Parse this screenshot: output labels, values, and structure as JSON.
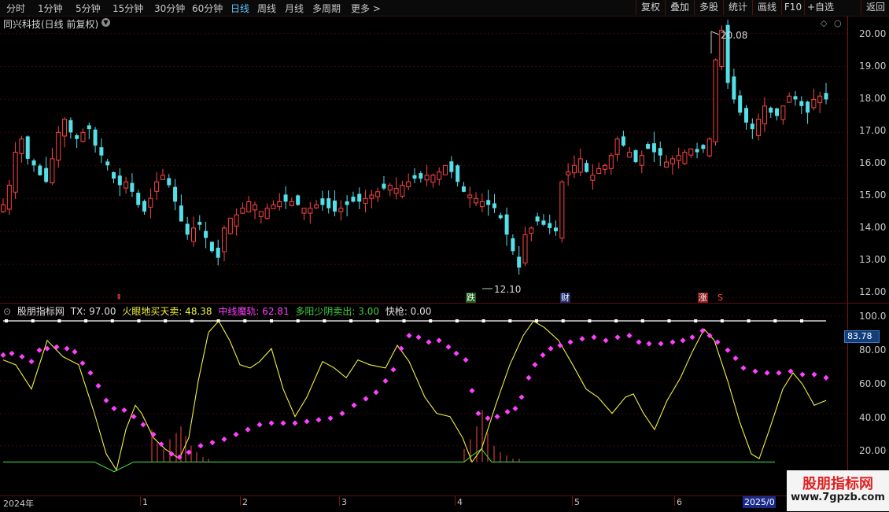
{
  "toolbar": {
    "periods": [
      "分时",
      "1分钟",
      "5分钟",
      "15分钟",
      "30分钟",
      "60分钟",
      "日线",
      "周线",
      "月线",
      "多周期",
      "更多 >"
    ],
    "active_period": "日线",
    "buttons": [
      "复权",
      "叠加",
      "多股",
      "统计",
      "画线",
      "F10",
      "+自选",
      "返回"
    ]
  },
  "stock": {
    "title": "同兴科技(日线 前复权)",
    "high_label": "20.08",
    "low_label": "12.10",
    "y_axis_ticks": [
      "20.00",
      "19.00",
      "18.00",
      "17.00",
      "16.00",
      "15.00",
      "14.00",
      "13.00",
      "12.00"
    ],
    "events": {
      "fall": "跌",
      "finance": "财",
      "rise": "涨",
      "mark_s": "S"
    }
  },
  "indicator": {
    "name": "股朋指标网",
    "items": [
      {
        "text": "TX: 97.00",
        "color": "#e0e0e0"
      },
      {
        "text": "火眼地买天卖: 48.38",
        "color": "#f0f040"
      },
      {
        "text": "中线魔轨: 62.81",
        "color": "#ff40ff"
      },
      {
        "text": "多阳少阴卖出: 3.00",
        "color": "#40d040"
      },
      {
        "text": "快枪: 0.00",
        "color": "#e0e0e0"
      }
    ],
    "y_axis_ticks": [
      "100.0",
      "80.00",
      "60.00",
      "40.00",
      "20.00"
    ],
    "current_tag": "83.78"
  },
  "date_axis": {
    "labels": [
      "2024年",
      "1",
      "2",
      "3",
      "4",
      "5",
      "6"
    ],
    "end_label": "2025/0"
  },
  "watermark": {
    "title": "股朋指标网",
    "url": "www.7gpzb.com"
  },
  "colors": {
    "up": "#ff4444",
    "down": "#54e0e8",
    "yellow_line": "#f0f040",
    "magenta_dots": "#ff40ff",
    "green_line": "#40d040",
    "axis_red": "#7a1414"
  },
  "chart_data": {
    "type": "candlestick",
    "price_range": [
      12.0,
      20.3
    ],
    "candles_close": [
      14.8,
      15.4,
      16.4,
      16.8,
      16.2,
      16.0,
      15.7,
      15.5,
      16.2,
      17.0,
      17.4,
      17.0,
      16.8,
      17.0,
      17.1,
      16.6,
      16.3,
      16.0,
      15.6,
      15.4,
      15.5,
      15.2,
      14.8,
      14.6,
      15.0,
      15.5,
      15.7,
      15.4,
      14.9,
      14.3,
      13.9,
      14.1,
      14.2,
      13.8,
      13.4,
      13.2,
      14.1,
      14.4,
      14.5,
      14.7,
      14.9,
      14.8,
      14.6,
      14.7,
      14.8,
      14.9,
      14.9,
      14.9,
      14.8,
      14.7,
      14.7,
      14.8,
      14.8,
      14.7,
      14.6,
      14.7,
      14.8,
      14.9,
      14.9,
      15.0,
      15.1,
      15.2,
      15.3,
      15.4,
      15.3,
      15.4,
      15.5,
      15.6,
      15.6,
      15.7,
      15.7,
      15.8,
      16.0,
      15.8,
      15.5,
      15.2,
      15.1,
      15.0,
      14.9,
      14.8,
      14.7,
      14.4,
      13.9,
      13.4,
      12.9,
      13.9,
      14.1,
      14.3,
      14.2,
      14.1,
      14.0,
      15.5,
      15.8,
      16.0,
      16.2,
      15.8,
      15.7,
      15.9,
      16.0,
      16.3,
      16.8,
      16.6,
      16.4,
      16.1,
      16.3,
      16.5,
      16.4,
      16.3,
      16.1,
      16.2,
      16.3,
      16.4,
      16.5,
      16.4,
      16.5,
      16.8,
      19.2,
      20.1,
      18.5,
      18.0,
      17.6,
      17.3,
      17.1,
      17.4,
      17.8,
      17.6,
      17.5,
      17.8,
      18.1,
      18.0,
      17.8,
      17.6,
      18.0,
      18.1,
      18.0
    ],
    "indicator_range": [
      0,
      100
    ]
  }
}
